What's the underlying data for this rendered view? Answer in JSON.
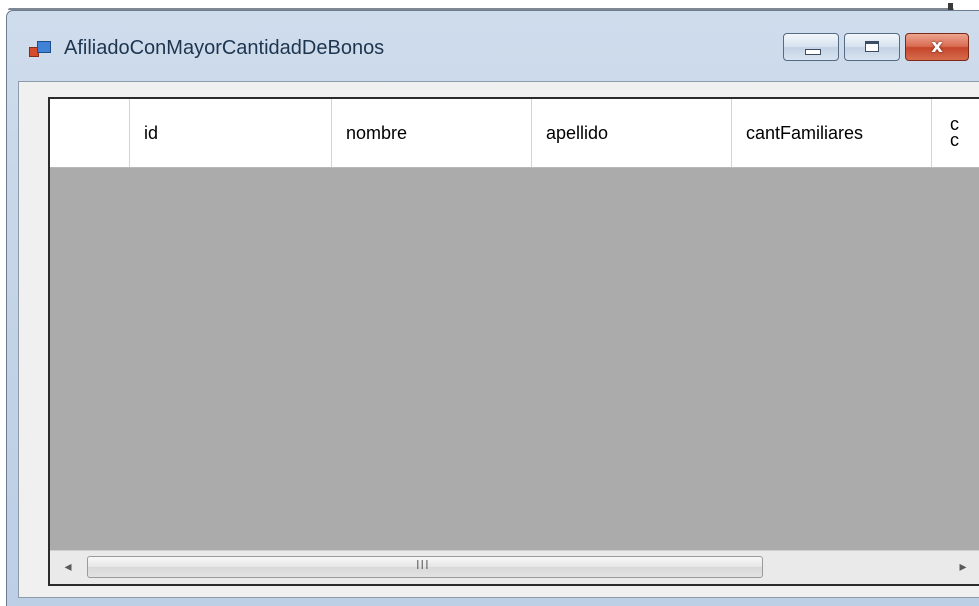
{
  "window": {
    "title": "AfiliadoConMayorCantidadDeBonos",
    "controls": {
      "minimize": "minimize",
      "maximize": "maximize",
      "close": "x"
    }
  },
  "grid": {
    "columns": [
      "id",
      "nombre",
      "apellido",
      "cantFamiliares"
    ],
    "cut_column_fragment": "c\nc",
    "rows": []
  },
  "scrollbar": {
    "left_arrow": "◂",
    "right_arrow": "▸",
    "grip": "III"
  },
  "colors": {
    "grid_background": "#ababab",
    "header_background": "#ffffff",
    "client_background": "#f0f0f0",
    "close_button": "#c6452a"
  },
  "icons": {
    "app": "app-window-icon",
    "minimize": "minimize-icon",
    "maximize": "maximize-icon",
    "close": "close-icon"
  }
}
